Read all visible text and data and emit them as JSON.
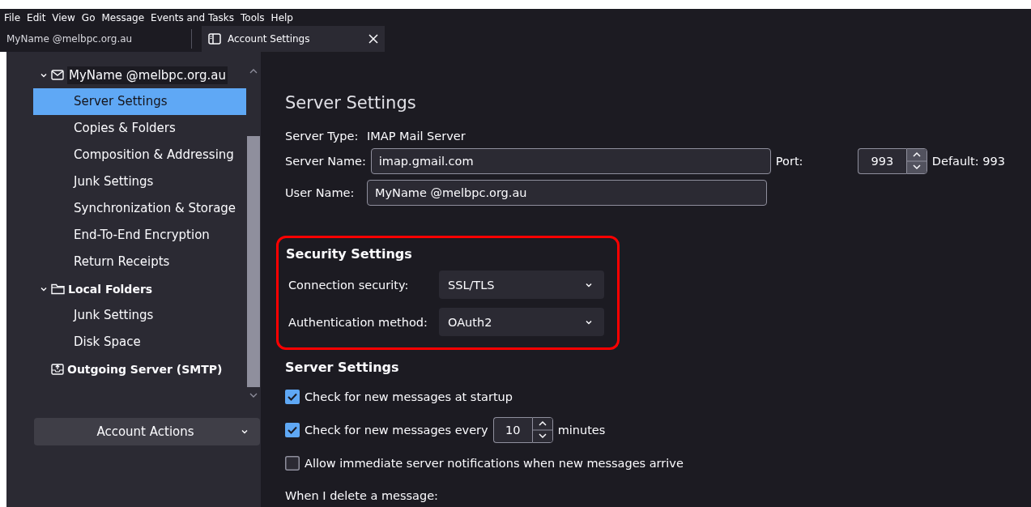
{
  "menu": [
    "File",
    "Edit",
    "View",
    "Go",
    "Message",
    "Events and Tasks",
    "Tools",
    "Help"
  ],
  "tabs": [
    {
      "label": "MyName @melbpc.org.au",
      "selected": false,
      "kind": "mail"
    },
    {
      "label": "Account Settings",
      "selected": true,
      "kind": "settings"
    }
  ],
  "sidebar": {
    "nodes": [
      {
        "label": "MyName @melbpc.org.au",
        "kind": "mail",
        "expanded": true,
        "children": [
          {
            "label": "Server Settings",
            "selected": true
          },
          {
            "label": "Copies & Folders",
            "selected": false
          },
          {
            "label": "Composition & Addressing",
            "selected": false
          },
          {
            "label": "Junk Settings",
            "selected": false
          },
          {
            "label": "Synchronization & Storage",
            "selected": false
          },
          {
            "label": "End-To-End Encryption",
            "selected": false
          },
          {
            "label": "Return Receipts",
            "selected": false
          }
        ]
      },
      {
        "label": "Local Folders",
        "kind": "folder",
        "expanded": true,
        "children": [
          {
            "label": "Junk Settings",
            "selected": false
          },
          {
            "label": "Disk Space",
            "selected": false
          }
        ]
      },
      {
        "label": "Outgoing Server (SMTP)",
        "kind": "outbox"
      }
    ],
    "action_button": "Account Actions"
  },
  "main": {
    "title": "Server Settings",
    "server_type": {
      "label": "Server Type:",
      "value": "IMAP Mail Server"
    },
    "server_name": {
      "label": "Server Name:",
      "value": "imap.gmail.com"
    },
    "port": {
      "label": "Port:",
      "value": "993",
      "default": "Default: 993"
    },
    "user_name": {
      "label": "User Name:",
      "value": "MyName @melbpc.org.au"
    },
    "security": {
      "title": "Security Settings",
      "fields": [
        {
          "label": "Connection security:",
          "value": "SSL/TLS"
        },
        {
          "label": "Authentication method:",
          "value": "OAuth2"
        }
      ]
    },
    "server": {
      "title": "Server Settings",
      "options": [
        {
          "kind": "check",
          "label": "Check for new messages at startup",
          "checked": true
        },
        {
          "kind": "interval",
          "label": "Check for new messages every",
          "checked": true,
          "value": "10",
          "suffix": "minutes"
        },
        {
          "kind": "check",
          "label": "Allow immediate server notifications when new messages arrive",
          "checked": false
        }
      ]
    },
    "delete_label": "When I delete a message:"
  }
}
